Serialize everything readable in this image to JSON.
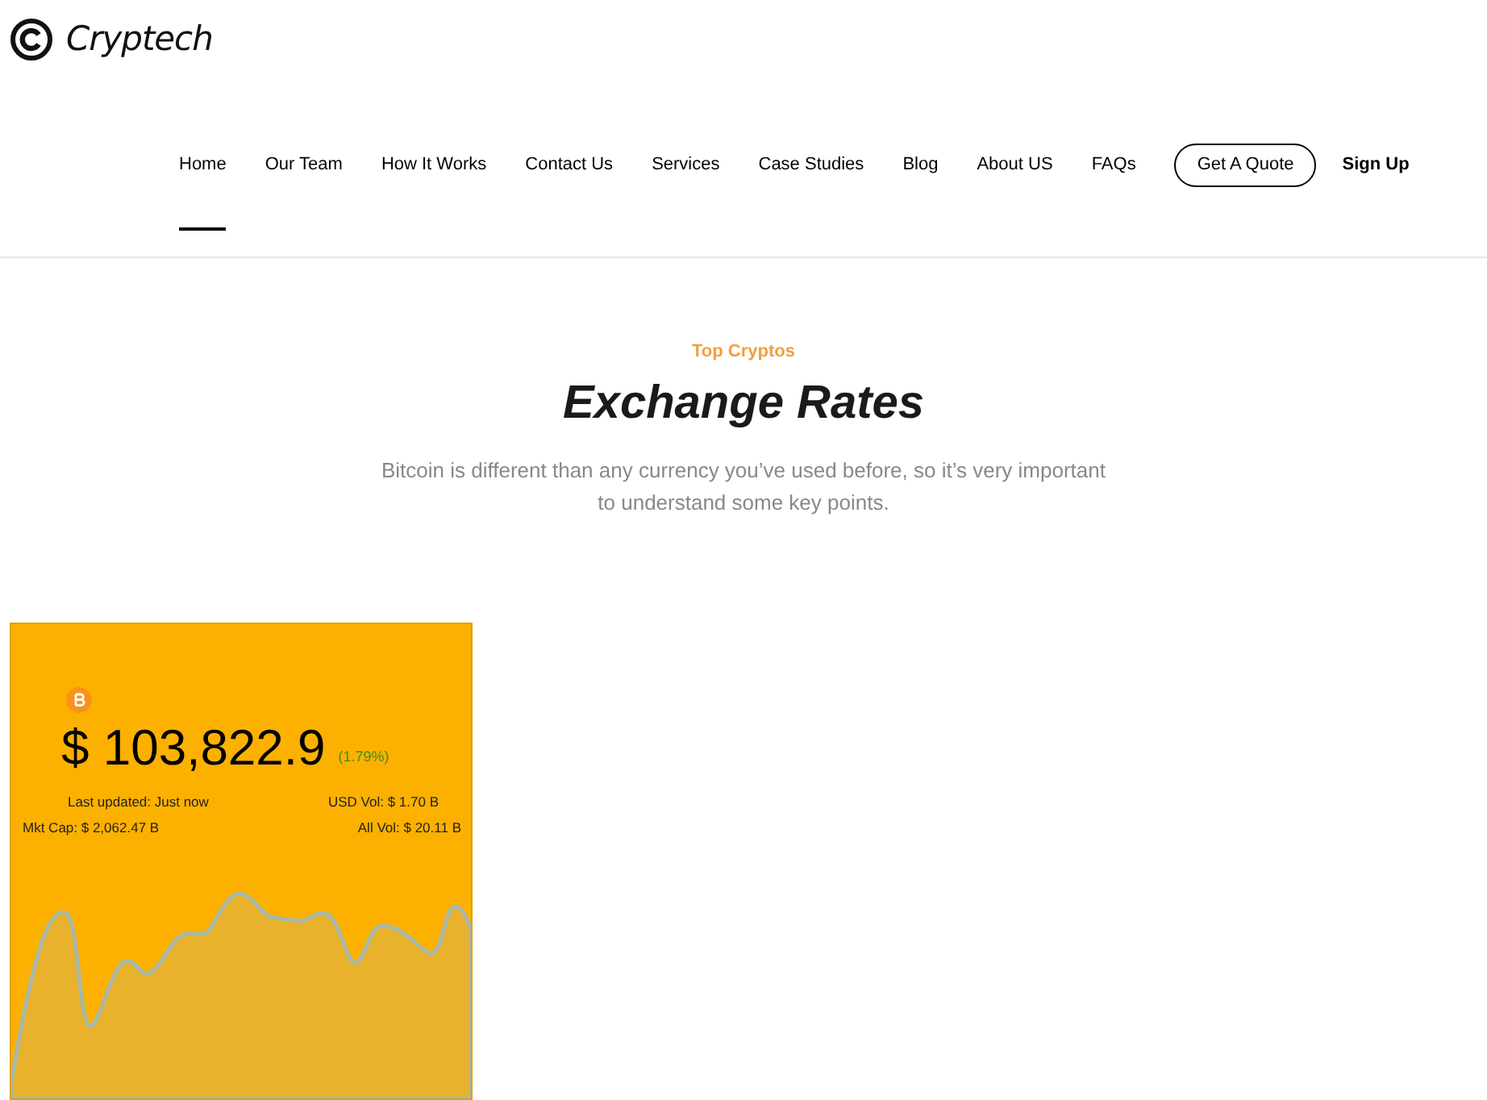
{
  "brand": {
    "name": "Cryptech"
  },
  "nav": [
    {
      "label": "Home",
      "selected": true
    },
    {
      "label": "Our Team",
      "selected": false
    },
    {
      "label": "How It Works",
      "selected": false
    },
    {
      "label": "Contact Us",
      "selected": false
    },
    {
      "label": "Services",
      "selected": false
    },
    {
      "label": "Case Studies",
      "selected": false
    },
    {
      "label": "Blog",
      "selected": false
    },
    {
      "label": "About US",
      "selected": false
    },
    {
      "label": "FAQs",
      "selected": false
    }
  ],
  "quote_button": "Get A Quote",
  "signup_link": "Sign Up",
  "section": {
    "eyebrow": "Top Cryptos",
    "title": "Exchange Rates",
    "description": "Bitcoin is different than any currency you’ve used before, so it’s very important to understand some key points."
  },
  "ticker": {
    "price": "$ 103,822.9",
    "change": "(1.79%)",
    "last_updated": "Last updated: Just now",
    "usd_vol": "USD Vol: $ 1.70 B",
    "mkt_cap": "Mkt Cap: $ 2,062.47 B",
    "all_vol": "All Vol: $ 20.11 B"
  }
}
